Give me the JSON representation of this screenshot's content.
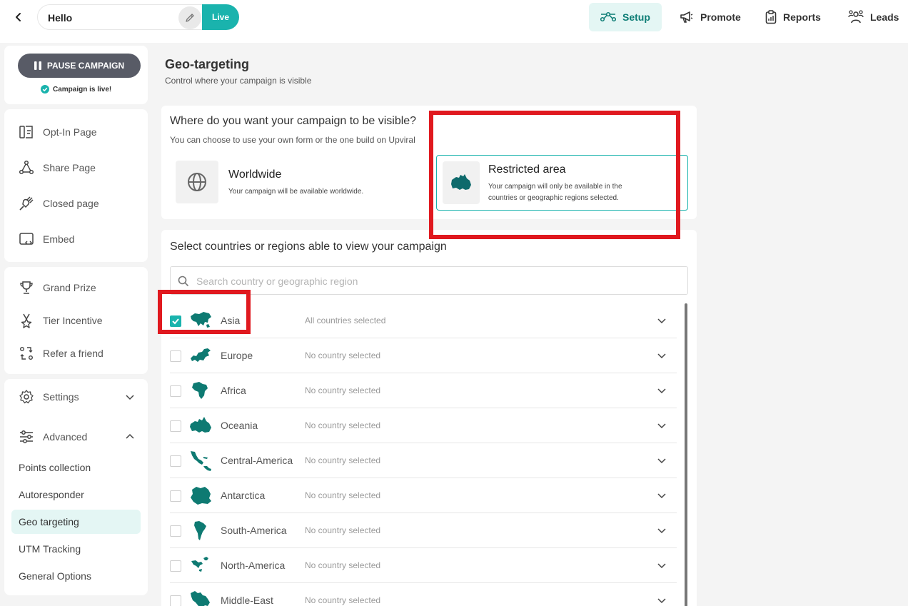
{
  "header": {
    "campaign_name": "Hello",
    "live_label": "Live",
    "nav": {
      "setup": "Setup",
      "promote": "Promote",
      "reports": "Reports",
      "leads": "Leads"
    }
  },
  "sidebar": {
    "pause_label": "PAUSE CAMPAIGN",
    "status_note": "Campaign is live!",
    "pages": [
      "Opt-In Page",
      "Share Page",
      "Closed page",
      "Embed"
    ],
    "incentives": [
      "Grand Prize",
      "Tier Incentive",
      "Refer a friend"
    ],
    "settings": "Settings",
    "advanced": "Advanced",
    "advanced_items": [
      "Points collection",
      "Autoresponder",
      "Geo targeting",
      "UTM Tracking",
      "General Options"
    ]
  },
  "main": {
    "title": "Geo-targeting",
    "subtitle": "Control where your campaign is visible",
    "visibility": {
      "question": "Where do you want your campaign to be visible?",
      "hint": "You can choose to use your own form or the one build on Upviral",
      "worldwide_title": "Worldwide",
      "worldwide_desc": "Your campaign will be available worldwide.",
      "restricted_title": "Restricted area",
      "restricted_desc_1": "Your campaign will only be available in the",
      "restricted_desc_2": "countries or geographic regions selected."
    },
    "regions_title": "Select countries or regions able to view your campaign",
    "search_placeholder": "Search country or geographic region",
    "regions": [
      {
        "name": "Asia",
        "status": "All countries selected",
        "checked": true
      },
      {
        "name": "Europe",
        "status": "No country selected",
        "checked": false
      },
      {
        "name": "Africa",
        "status": "No country selected",
        "checked": false
      },
      {
        "name": "Oceania",
        "status": "No country selected",
        "checked": false
      },
      {
        "name": "Central-America",
        "status": "No country selected",
        "checked": false
      },
      {
        "name": "Antarctica",
        "status": "No country selected",
        "checked": false
      },
      {
        "name": "South-America",
        "status": "No country selected",
        "checked": false
      },
      {
        "name": "North-America",
        "status": "No country selected",
        "checked": false
      },
      {
        "name": "Middle-East",
        "status": "No country selected",
        "checked": false
      }
    ]
  },
  "colors": {
    "accent": "#1ab3ad",
    "accent_dark": "#0d7d75",
    "map_fill": "#0e7a72",
    "highlight_red": "#e0191f",
    "pause_button": "#585b66"
  }
}
